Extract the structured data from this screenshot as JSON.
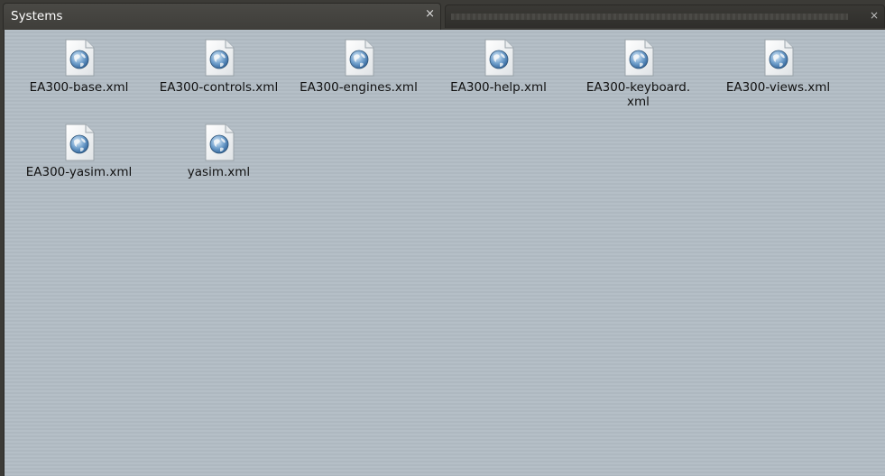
{
  "window": {
    "tab_title": "Systems",
    "tab_close_glyph": "×",
    "second_tab_close_glyph": "×"
  },
  "files": [
    {
      "name": "EA300-base.xml",
      "icon": "xml-document-icon"
    },
    {
      "name": "EA300-controls.xml",
      "icon": "xml-document-icon"
    },
    {
      "name": "EA300-engines.xml",
      "icon": "xml-document-icon"
    },
    {
      "name": "EA300-help.xml",
      "icon": "xml-document-icon"
    },
    {
      "name": "EA300-keyboard.\nxml",
      "icon": "xml-document-icon"
    },
    {
      "name": "EA300-views.xml",
      "icon": "xml-document-icon"
    },
    {
      "name": "EA300-yasim.xml",
      "icon": "xml-document-icon"
    },
    {
      "name": "yasim.xml",
      "icon": "xml-document-icon"
    }
  ],
  "colors": {
    "window_bg": "#3c3b37",
    "view_bg": "#b5bfc7",
    "text": "#111111"
  }
}
